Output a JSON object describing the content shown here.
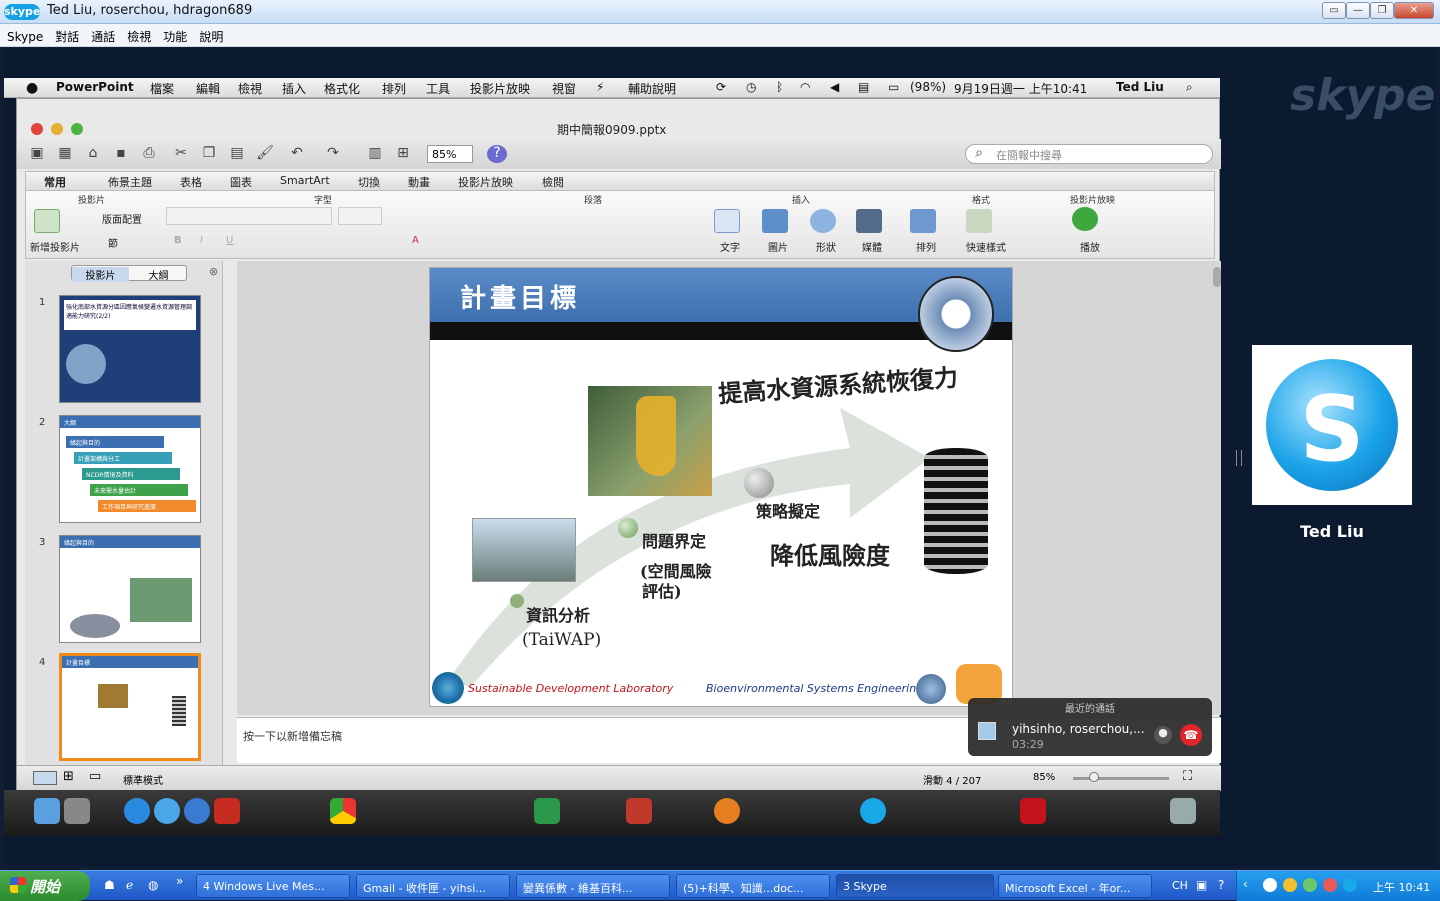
{
  "skype": {
    "logo": "skype",
    "title": "Ted Liu, roserchou, hdragon689",
    "menu": [
      "Skype",
      "對話",
      "通話",
      "檢視",
      "功能",
      "說明"
    ],
    "watermark": "skype",
    "remote_name": "Ted Liu"
  },
  "mac_menubar": {
    "app": "PowerPoint",
    "items": [
      "檔案",
      "編輯",
      "檢視",
      "插入",
      "格式化",
      "排列",
      "工具",
      "投影片放映",
      "視窗",
      "輔助說明"
    ],
    "battery": "(98%)",
    "datetime": "9月19日週一 上午10:41",
    "user": "Ted Liu"
  },
  "ppt": {
    "doc_title": "期中簡報0909.pptx",
    "zoom": "85%",
    "search_placeholder": "在簡報中搜尋",
    "tabs": [
      "常用",
      "佈景主題",
      "表格",
      "圖表",
      "SmartArt",
      "切換",
      "動畫",
      "投影片放映",
      "檢閱"
    ],
    "groups": {
      "slides": "投影片",
      "font": "字型",
      "paragraph": "段落",
      "insert": "插入",
      "format": "格式",
      "slideshow": "投影片放映"
    },
    "ribbon_labels": {
      "new_slide": "新增投影片",
      "layout": "版面配置",
      "section": "節",
      "text": "文字",
      "picture": "圖片",
      "shape": "形狀",
      "media": "媒體",
      "arrange": "排列",
      "quick_styles": "快速樣式",
      "play": "播放"
    },
    "panel_tabs": [
      "投影片",
      "大綱"
    ],
    "slide_numbers": [
      "1",
      "2",
      "3",
      "4"
    ],
    "notes_placeholder": "按一下以新增備忘稿",
    "status": {
      "view_mode": "標準模式",
      "slide_counter": "滑動 4 / 207",
      "zoom": "85%"
    }
  },
  "slide": {
    "title": "計畫目標",
    "headline": "提高水資源系統恢復力",
    "step1": "資訊分析",
    "step1b": "(TaiWAP)",
    "step2": "問題界定",
    "step2b": "(空間風險",
    "step2c": "評估)",
    "step3": "策略擬定",
    "risk": "降低風險度",
    "footer_left": "Sustainable Development Laboratory",
    "footer_right": "Bioenvironmental Systems Engineering"
  },
  "thumbs": {
    "t1_title": "強化南部水資源分區因應氣候變遷水資源管理調適能力研究(2/2)",
    "t2_items": [
      "緣起與目的",
      "計畫架構與分工",
      "NCDR情境及資料",
      "未來需水量估計",
      "工作項目與研究進度"
    ],
    "t2_title": "大綱",
    "t3_title": "緣起與目的",
    "t4_title": "計畫目標"
  },
  "call": {
    "header": "最近的通話",
    "name": "yihsinho, roserchou,...",
    "duration": "03:29"
  },
  "taskbar": {
    "start": "開始",
    "buttons": [
      "4 Windows Live Mes...",
      "Gmail - 收件匣 - yihsi...",
      "變異係數 - 維基百科...",
      "(5)+科學、知識...doc...",
      "3 Skype",
      "Microsoft Excel - 年or..."
    ],
    "lang": "CH",
    "clock": "上午 10:41"
  },
  "colors": {
    "slide_header": "#4a7cbd",
    "taskbar": "#2a66d0",
    "start": "#3a9a3a"
  }
}
